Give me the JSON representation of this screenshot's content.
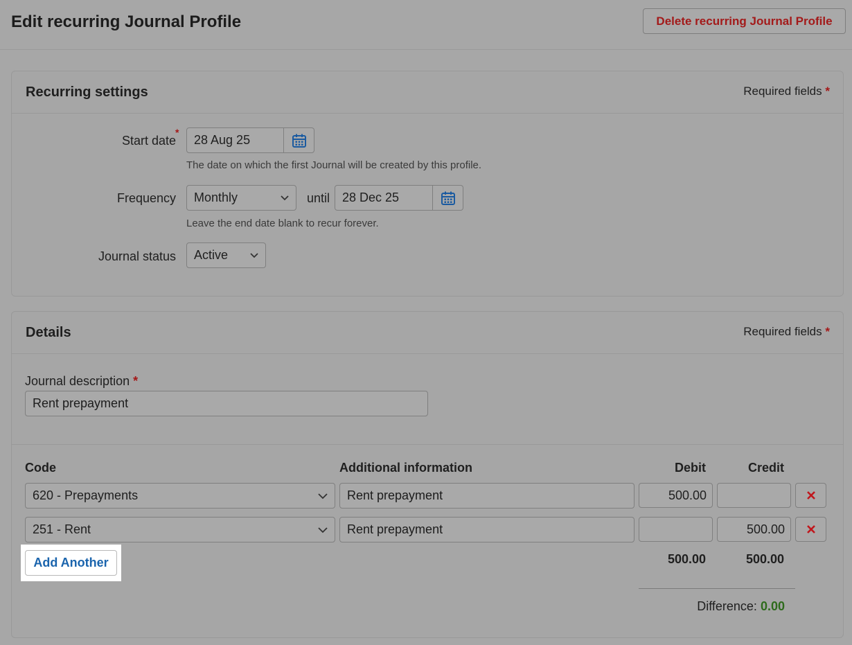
{
  "header": {
    "title": "Edit recurring Journal Profile",
    "delete_label": "Delete recurring Journal Profile"
  },
  "recurring": {
    "title": "Recurring settings",
    "required_label": "Required fields",
    "start_date_label": "Start date",
    "start_date_value": "28 Aug 25",
    "start_date_hint": "The date on which the first Journal will be created by this profile.",
    "frequency_label": "Frequency",
    "frequency_value": "Monthly",
    "until_label": "until",
    "end_date_value": "28 Dec 25",
    "end_date_hint": "Leave the end date blank to recur forever.",
    "status_label": "Journal status",
    "status_value": "Active"
  },
  "details": {
    "title": "Details",
    "required_label": "Required fields",
    "description_label": "Journal description",
    "description_value": "Rent prepayment",
    "columns": {
      "code": "Code",
      "info": "Additional information",
      "debit": "Debit",
      "credit": "Credit"
    },
    "lines": [
      {
        "code": "620 - Prepayments",
        "info": "Rent prepayment",
        "debit": "500.00",
        "credit": ""
      },
      {
        "code": "251 - Rent",
        "info": "Rent prepayment",
        "debit": "",
        "credit": "500.00"
      }
    ],
    "add_label": "Add Another",
    "total_debit": "500.00",
    "total_credit": "500.00",
    "difference_label": "Difference:",
    "difference_value": "0.00"
  },
  "colors": {
    "required_star": "#a41818",
    "delete_text": "#a31a1a",
    "link_blue": "#1a64ad",
    "difference_green": "#2e6b1c",
    "remove_red": "#c0171d"
  },
  "icons": [
    "calendar-icon",
    "chevron-down-icon",
    "remove-icon"
  ]
}
